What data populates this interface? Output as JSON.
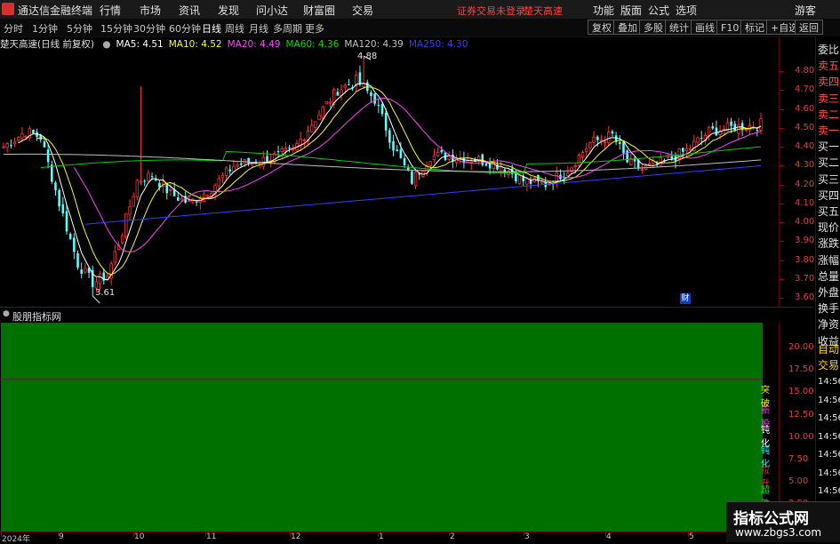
{
  "app": {
    "title": "通达信金融终端"
  },
  "menu": [
    "行情",
    "市场",
    "资讯",
    "发现",
    "问小达",
    "财富圈",
    "交易"
  ],
  "notice": {
    "login": "证券交易未登录",
    "stock": "楚天高速"
  },
  "right_menu": [
    "功能",
    "版面",
    "公式",
    "选项"
  ],
  "user": "游客",
  "periods": [
    "分时",
    "1分钟",
    "5分钟",
    "15分钟",
    "30分钟",
    "60分钟",
    "日线",
    "周线",
    "月线",
    "多周期",
    "更多"
  ],
  "active_period": "日线",
  "toolbar_buttons": [
    "复权",
    "叠加",
    "多股",
    "统计",
    "画线",
    "F10",
    "标记",
    "+自选",
    "返回"
  ],
  "legend": {
    "stock": "楚天高速",
    "info": "(日线 前复权)",
    "ma": [
      {
        "label": "MA5: 4.51",
        "color": "#ffffff"
      },
      {
        "label": "MA10: 4.52",
        "color": "#ffff00"
      },
      {
        "label": "MA20: 4.49",
        "color": "#ff40ff"
      },
      {
        "label": "MA60: 4.36",
        "color": "#00e000"
      },
      {
        "label": "MA120: 4.39",
        "color": "#c0c0c0"
      },
      {
        "label": "MA250: 4.30",
        "color": "#3040ff"
      }
    ]
  },
  "price_axis": [
    "4.80",
    "4.70",
    "4.60",
    "4.50",
    "4.40",
    "4.30",
    "4.20",
    "4.10",
    "4.00",
    "3.90",
    "3.80",
    "3.70",
    "3.60"
  ],
  "annotations": {
    "high": "4.88",
    "low": "3.61",
    "fin_marker": "财"
  },
  "side_panel": {
    "items": [
      "委比",
      "卖五",
      "卖四",
      "卖三",
      "卖二",
      "卖一",
      "买一",
      "买二",
      "买三",
      "买四",
      "买五",
      "现价",
      "涨跌",
      "涨幅",
      "总量",
      "外盘",
      "换手",
      "净资",
      "收益"
    ],
    "bottom_items": [
      "自动",
      "交易"
    ],
    "times": [
      "14:56",
      "14:56",
      "14:56",
      "14:56",
      "14:56",
      "14:56",
      "14:56",
      "14:56"
    ]
  },
  "subchart": {
    "title": "股朋指标网",
    "axis": [
      "20.00",
      "17.50",
      "15.00",
      "12.50",
      "10.00",
      "7.50",
      "5.00",
      "2.50"
    ],
    "labels": [
      {
        "text": "突破",
        "color": "#ffff00"
      },
      {
        "text": "新股",
        "color": "#ff40ff"
      },
      {
        "text": "钝化",
        "color": "#ffffff"
      },
      {
        "text": "钝化",
        "color": "#00ffff"
      },
      {
        "text": "拉升",
        "color": "#ff3030"
      },
      {
        "text": "超跌",
        "color": "#00ff00"
      }
    ]
  },
  "x_axis": [
    "2024年",
    "9",
    "10",
    "11",
    "12",
    "1",
    "2",
    "3",
    "4",
    "5"
  ],
  "watermark": {
    "title": "指标公式网",
    "url": "www.zbgs3.com"
  },
  "colors": {
    "up": "#ff3232",
    "down": "#54ffff",
    "ma250": "#3040ff",
    "sub_fill": "#007000"
  }
}
